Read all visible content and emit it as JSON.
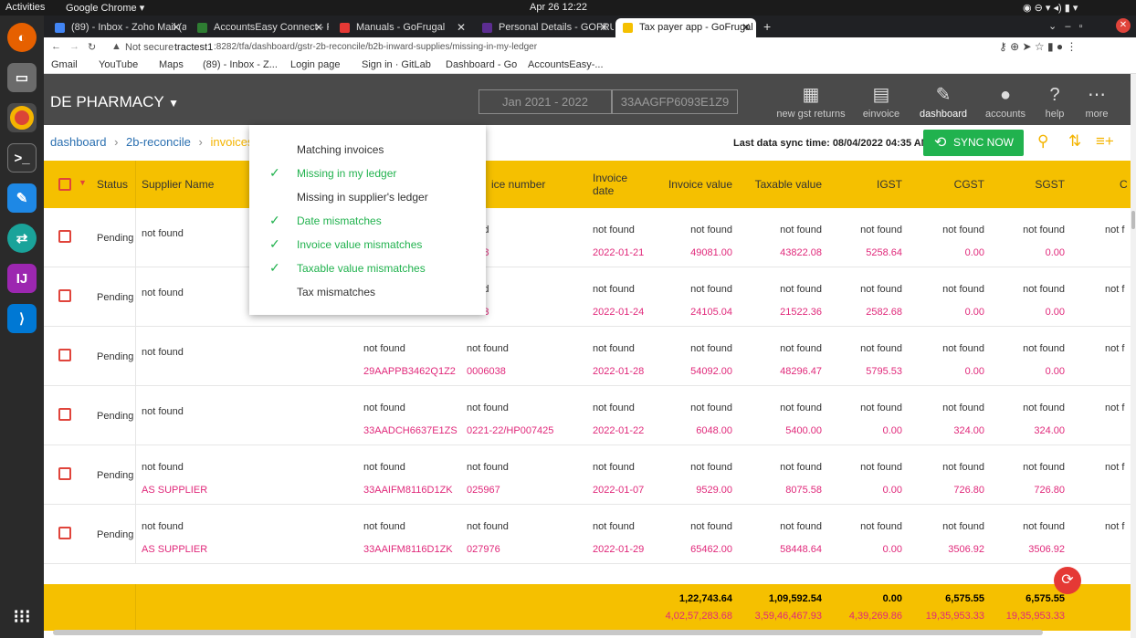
{
  "os": {
    "activities": "Activities",
    "app": "Google Chrome ▾",
    "clock": "Apr 26  12:22"
  },
  "tabs": [
    {
      "label": "(89) - Inbox - Zoho Mail (al",
      "color": "#4285f4"
    },
    {
      "label": "AccountsEasy Connect - F",
      "color": "#2e7d32"
    },
    {
      "label": "Manuals - GoFrugal",
      "color": "#e53935"
    },
    {
      "label": "Personal Details - GOFRU",
      "color": "#5c2d91"
    },
    {
      "label": "Tax payer app - GoFrugal",
      "color": "#f5c000"
    }
  ],
  "address": {
    "secure": "Not secure",
    "host": "tractest1",
    "path": ":8282/tfa/dashboard/gstr-2b-reconcile/b2b-inward-supplies/missing-in-my-ledger"
  },
  "bookmarks": [
    "Gmail",
    "YouTube",
    "Maps",
    "(89) - Inbox - Z...",
    "Login page",
    "Sign in · GitLab",
    "Dashboard - Go",
    "AccountsEasy-..."
  ],
  "app": {
    "company": "DE PHARMACY",
    "period": "Jan 2021 - 2022",
    "gstin": "33AAGFP6093E1Z9",
    "nav": [
      {
        "label": "new gst returns",
        "icon": "grid-icon",
        "glyph": "▦"
      },
      {
        "label": "einvoice",
        "icon": "document-icon",
        "glyph": "▤"
      },
      {
        "label": "dashboard",
        "icon": "pen-icon",
        "glyph": "✎"
      },
      {
        "label": "accounts",
        "icon": "person-icon",
        "glyph": "●"
      },
      {
        "label": "help",
        "icon": "help-icon",
        "glyph": "?"
      },
      {
        "label": "more",
        "icon": "more-icon",
        "glyph": "⋯"
      }
    ],
    "crumbs": [
      "dashboard",
      "2b-reconcile",
      "invoices"
    ],
    "sync_text": "Last data sync time: 08/04/2022 04:35 AM",
    "sync_button": "SYNC NOW"
  },
  "menu": [
    {
      "label": "Matching invoices",
      "checked": false
    },
    {
      "label": "Missing in my ledger",
      "checked": true
    },
    {
      "label": "Missing in supplier's ledger",
      "checked": false
    },
    {
      "label": "Date mismatches",
      "checked": true
    },
    {
      "label": "Invoice value mismatches",
      "checked": true
    },
    {
      "label": "Taxable value mismatches",
      "checked": true
    },
    {
      "label": "Tax mismatches",
      "checked": false
    }
  ],
  "columns": {
    "status": "Status",
    "supplier": "Supplier Name",
    "invno": "ice number",
    "date": "Invoice date",
    "value": "Invoice value",
    "taxable": "Taxable value",
    "igst": "IGST",
    "cgst": "CGST",
    "sgst": "SGST",
    "extra": "C"
  },
  "rows": [
    {
      "status": "Pending",
      "supplier": "not found",
      "supplier2": "",
      "gstin": "",
      "gstin2": "",
      "inv": "ound",
      "inv2": "2198",
      "d": "not found",
      "d2": "2022-01-21",
      "v": "not found",
      "v2": "49081.00",
      "t": "not found",
      "t2": "43822.08",
      "i": "not found",
      "i2": "5258.64",
      "c": "not found",
      "c2": "0.00",
      "s": "not found",
      "s2": "0.00",
      "x": "not f"
    },
    {
      "status": "Pending",
      "supplier": "not found",
      "supplier2": "",
      "gstin": "",
      "gstin2": "",
      "inv": "ound",
      "inv2": "5953",
      "d": "not found",
      "d2": "2022-01-24",
      "v": "not found",
      "v2": "24105.04",
      "t": "not found",
      "t2": "21522.36",
      "i": "not found",
      "i2": "2582.68",
      "c": "not found",
      "c2": "0.00",
      "s": "not found",
      "s2": "0.00",
      "x": "not f"
    },
    {
      "status": "Pending",
      "supplier": "not found",
      "supplier2": "",
      "gstin": "not found",
      "gstin2": "29AAPPB3462Q1Z2",
      "inv": "not found",
      "inv2": "0006038",
      "d": "not found",
      "d2": "2022-01-28",
      "v": "not found",
      "v2": "54092.00",
      "t": "not found",
      "t2": "48296.47",
      "i": "not found",
      "i2": "5795.53",
      "c": "not found",
      "c2": "0.00",
      "s": "not found",
      "s2": "0.00",
      "x": "not f"
    },
    {
      "status": "Pending",
      "supplier": "not found",
      "supplier2": "",
      "gstin": "not found",
      "gstin2": "33AADCH6637E1ZS",
      "inv": "not found",
      "inv2": "0221-22/HP007425",
      "d": "not found",
      "d2": "2022-01-22",
      "v": "not found",
      "v2": "6048.00",
      "t": "not found",
      "t2": "5400.00",
      "i": "not found",
      "i2": "0.00",
      "c": "not found",
      "c2": "324.00",
      "s": "not found",
      "s2": "324.00",
      "x": "not f"
    },
    {
      "status": "Pending",
      "supplier": "not found",
      "supplier2": "AS SUPPLIER",
      "gstin": "not found",
      "gstin2": "33AAIFM8116D1ZK",
      "inv": "not found",
      "inv2": "025967",
      "d": "not found",
      "d2": "2022-01-07",
      "v": "not found",
      "v2": "9529.00",
      "t": "not found",
      "t2": "8075.58",
      "i": "not found",
      "i2": "0.00",
      "c": "not found",
      "c2": "726.80",
      "s": "not found",
      "s2": "726.80",
      "x": "not f"
    },
    {
      "status": "Pending",
      "supplier": "not found",
      "supplier2": "AS SUPPLIER",
      "gstin": "not found",
      "gstin2": "33AAIFM8116D1ZK",
      "inv": "not found",
      "inv2": "027976",
      "d": "not found",
      "d2": "2022-01-29",
      "v": "not found",
      "v2": "65462.00",
      "t": "not found",
      "t2": "58448.64",
      "i": "not found",
      "i2": "0.00",
      "c": "not found",
      "c2": "3506.92",
      "s": "not found",
      "s2": "3506.92",
      "x": "not f"
    }
  ],
  "totals": {
    "v": "1,22,743.64",
    "v2": "4,02,57,283.68",
    "t": "1,09,592.54",
    "t2": "3,59,46,467.93",
    "i": "0.00",
    "i2": "4,39,269.86",
    "c": "6,575.55",
    "c2": "19,35,953.33",
    "s": "6,575.55",
    "s2": "19,35,953.33"
  },
  "colors": {
    "accent": "#f5c000",
    "sync": "#21b24e",
    "pink": "#e0287a"
  }
}
